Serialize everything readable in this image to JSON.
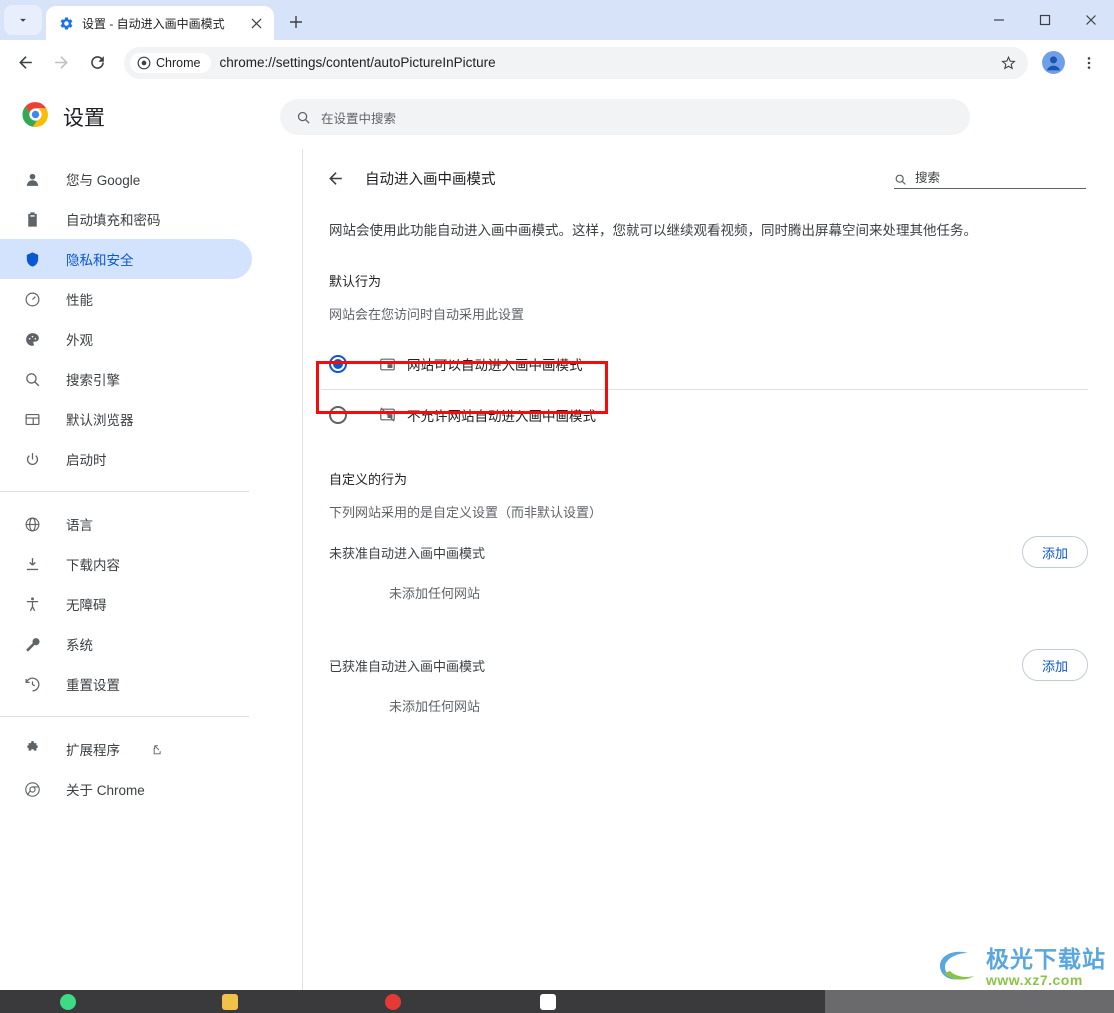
{
  "window": {
    "tab_search_icon": "chevron-down-icon",
    "minimize_label": "–",
    "maximize_label": "□",
    "close_label": "✕"
  },
  "tab": {
    "title": "设置 - 自动进入画中画模式",
    "favicon": "gear-icon",
    "close_icon": "close-icon",
    "new_tab_icon": "plus-icon"
  },
  "toolbar": {
    "back_icon": "back-arrow-icon",
    "forward_icon": "forward-arrow-icon",
    "reload_icon": "reload-icon",
    "chrome_chip_label": "Chrome",
    "url": "chrome://settings/content/autoPictureInPicture",
    "star_icon": "star-icon",
    "profile_icon": "profile-avatar-icon",
    "menu_icon": "three-dot-menu-icon"
  },
  "settings": {
    "brand_title": "设置",
    "logo": "chrome-logo-icon",
    "search_placeholder": "在设置中搜索",
    "search_icon": "search-icon"
  },
  "sidebar": {
    "items": [
      {
        "label": "您与 Google",
        "icon": "person-icon",
        "active": false
      },
      {
        "label": "自动填充和密码",
        "icon": "clipboard-icon",
        "active": false
      },
      {
        "label": "隐私和安全",
        "icon": "shield-icon",
        "active": true
      },
      {
        "label": "性能",
        "icon": "speedometer-icon",
        "active": false
      },
      {
        "label": "外观",
        "icon": "palette-icon",
        "active": false
      },
      {
        "label": "搜索引擎",
        "icon": "search-icon",
        "active": false
      },
      {
        "label": "默认浏览器",
        "icon": "browser-window-icon",
        "active": false
      },
      {
        "label": "启动时",
        "icon": "power-icon",
        "active": false
      }
    ],
    "items2": [
      {
        "label": "语言",
        "icon": "globe-icon"
      },
      {
        "label": "下载内容",
        "icon": "download-icon"
      },
      {
        "label": "无障碍",
        "icon": "accessibility-icon"
      },
      {
        "label": "系统",
        "icon": "wrench-icon"
      },
      {
        "label": "重置设置",
        "icon": "history-restore-icon"
      }
    ],
    "items3": [
      {
        "label": "扩展程序",
        "icon": "puzzle-icon",
        "external": true
      },
      {
        "label": "关于 Chrome",
        "icon": "chrome-circle-icon",
        "external": false
      }
    ]
  },
  "main": {
    "back_icon": "back-arrow-icon",
    "title": "自动进入画中画模式",
    "search_placeholder": "搜索",
    "search_icon": "search-icon",
    "description": "网站会使用此功能自动进入画中画模式。这样，您就可以继续观看视频，同时腾出屏幕空间来处理其他任务。",
    "default_behavior_title": "默认行为",
    "default_behavior_sub": "网站会在您访问时自动采用此设置",
    "radio_options": [
      {
        "label": "网站可以自动进入画中画模式",
        "icon": "picture-in-picture-icon",
        "selected": true
      },
      {
        "label": "不允许网站自动进入画中画模式",
        "icon": "picture-in-picture-off-icon",
        "selected": false
      }
    ],
    "custom_behavior_title": "自定义的行为",
    "custom_behavior_sub": "下列网站采用的是自定义设置（而非默认设置）",
    "perm_blocked_label": "未获准自动进入画中画模式",
    "perm_blocked_empty": "未添加任何网站",
    "perm_allowed_label": "已获准自动进入画中画模式",
    "perm_allowed_empty": "未添加任何网站",
    "add_button_label": "添加"
  },
  "annotation": {
    "highlight_color": "#f40b0b"
  },
  "watermark": {
    "main": "极光下载站",
    "sub": "www.xz7.com"
  },
  "colors": {
    "accent_blue": "#0b57d0",
    "active_pill": "#d3e3fd",
    "tabstrip": "#d6e3f8",
    "omnibox": "#f1f3f4"
  }
}
